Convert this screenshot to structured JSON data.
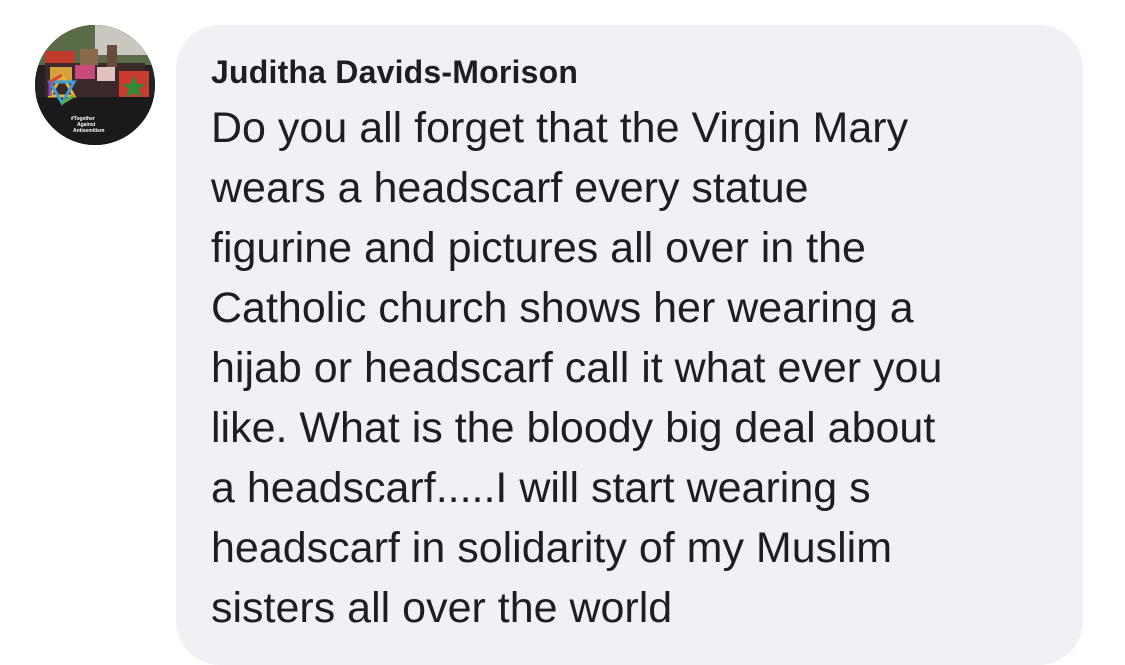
{
  "comment": {
    "author_name": "Juditha Davids-Morison",
    "lines": [
      "Do you all forget that the Virgin Mary",
      "wears a headscarf every statue",
      "figurine and pictures all over in the",
      "Catholic church shows her wearing a",
      "hijab or headscarf call it what ever you",
      "like. What is the bloody big deal about",
      "a headscarf.....I will start wearing s",
      "headscarf in solidarity of my Muslim",
      "sisters all over the world"
    ]
  },
  "avatar": {
    "badge_text": [
      "#Together",
      "Against",
      "Antisemitism"
    ],
    "icon": "star-of-david-icon"
  },
  "colors": {
    "bubble_background": "#f0f1f4",
    "text": "#1c1e21",
    "page_background": "#ffffff"
  }
}
